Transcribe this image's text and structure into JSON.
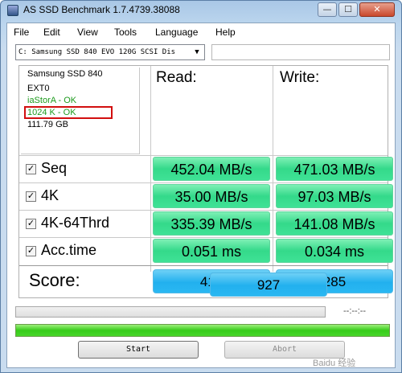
{
  "window": {
    "title": "AS SSD Benchmark 1.7.4739.38088",
    "min": "—",
    "max": "☐",
    "close": "✕"
  },
  "menu": [
    "File",
    "Edit",
    "View",
    "Tools",
    "Language",
    "Help"
  ],
  "drive_select": {
    "value": "C: Samsung SSD 840 EVO 120G SCSI Dis",
    "arrow": "▼"
  },
  "info": {
    "model": "Samsung SSD 840",
    "firmware": "EXT0",
    "driver": "iaStorA - OK",
    "alignment": "1024 K - OK",
    "size": "111.79 GB"
  },
  "columns": {
    "read": "Read:",
    "write": "Write:"
  },
  "checkmark": "✓",
  "rows": [
    {
      "label": "Seq",
      "checked": true,
      "read": "452.04 MB/s",
      "write": "471.03 MB/s"
    },
    {
      "label": "4K",
      "checked": true,
      "read": "35.00 MB/s",
      "write": "97.03 MB/s"
    },
    {
      "label": "4K-64Thrd",
      "checked": true,
      "read": "335.39 MB/s",
      "write": "141.08 MB/s"
    },
    {
      "label": "Acc.time",
      "checked": true,
      "read": "0.051 ms",
      "write": "0.034 ms"
    }
  ],
  "score": {
    "label": "Score:",
    "read": "416",
    "write": "285",
    "total": "927"
  },
  "progress": {
    "time": "--:--:--",
    "upper_fill": 0,
    "lower_fill": 1.0
  },
  "buttons": {
    "start": "Start",
    "abort": "Abort"
  },
  "watermark": "Baidu 经验",
  "colors": {
    "result_green": "#3fe296",
    "score_blue": "#2ab8f2",
    "ok_green": "#1e9b1e",
    "highlight_red": "#d20f0f"
  }
}
